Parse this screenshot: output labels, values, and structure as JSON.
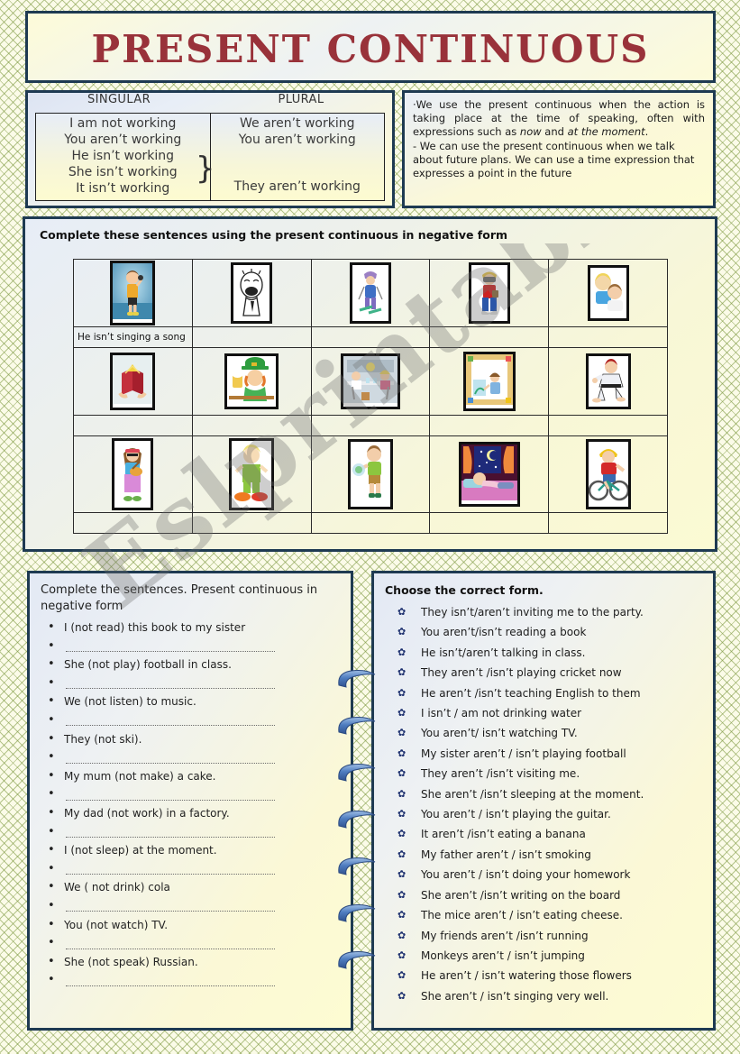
{
  "title": {
    "text": "PRESENT CONTINUOUS",
    "color": "#99323a"
  },
  "watermark": {
    "text": "Eslprintables.com"
  },
  "forms": {
    "singular_header": "SINGULAR",
    "plural_header": "PLURAL",
    "singular": [
      "I am not working",
      "You aren’t working",
      "He isn’t working",
      "She  isn’t working",
      "It isn’t working"
    ],
    "plural": [
      "We aren’t working",
      "You aren’t working",
      "They  aren’t working"
    ]
  },
  "usage": {
    "line1": "·We use  the present continuous when the action is taking place at  the  time  of  speaking,  often  with expressions such as ",
    "line1_em1": "now",
    "line1_mid": " and ",
    "line1_em2": "at the moment",
    "line1_end": ".",
    "line2": "- We can use the present continuous when we talk about future plans. We can use a time expression that expresses a point in the future"
  },
  "grid": {
    "instruction": "Complete these sentences using the present continuous in negative form",
    "rows": [
      {
        "pictures": [
          "boy-singing-microphone",
          "man-laughing-sketch",
          "girl-skiing",
          "boy-taking-photo",
          "two-girls-talking"
        ],
        "answers": [
          "He isn’t singing a song",
          "",
          "",
          "",
          ""
        ]
      },
      {
        "pictures": [
          "open-red-book",
          "leprechaun-drinking-beer",
          "kids-in-science-lab",
          "child-painting-picture",
          "boy-doing-karate"
        ],
        "answers": [
          "",
          "",
          "",
          "",
          ""
        ]
      },
      {
        "pictures": [
          "girl-playing-guitar",
          "child-running",
          "boy-playing-ball",
          "man-sleeping-in-bed",
          "boy-riding-bicycle"
        ],
        "answers": [
          "",
          "",
          "",
          "",
          ""
        ]
      }
    ]
  },
  "left_exercise": {
    "heading": "Complete the sentences. Present  continuous  in negative form",
    "items": [
      "I (not read) this book to my sister",
      "She (not play) football in class.",
      "We (not listen) to music.",
      "They (not ski).",
      "My mum (not make) a cake.",
      "My dad (not work) in a factory.",
      "I (not sleep) at the moment.",
      "We ( not drink) cola",
      "You (not watch) TV.",
      "She (not speak) Russian."
    ]
  },
  "right_exercise": {
    "heading": "Choose the correct form.",
    "items": [
      "They isn’t/aren’t inviting me to the party.",
      "You aren’t/isn’t  reading a book",
      "He isn’t/aren’t talking in class.",
      "They aren’t /isn’t playing cricket now",
      "He aren’t /isn’t teaching English to them",
      "I isn’t / am not drinking water",
      "You aren’t/ isn’t watching TV.",
      "My sister aren’t / isn’t playing football",
      "They aren’t /isn’t  visiting me.",
      "She aren’t /isn’t sleeping at the moment.",
      "You aren’t / isn’t playing the guitar.",
      "It aren’t /isn’t eating a banana",
      "My father aren’t / isn’t  smoking",
      "You aren’t / isn’t doing your homework",
      "She aren’t /isn’t writing on the board",
      "The mice aren’t / isn’t eating cheese.",
      "My friends aren’t /isn’t running",
      "Monkeys aren’t / isn’t jumping",
      "He aren’t / isn’t watering those flowers",
      "She aren’t / isn’t singing very well."
    ]
  },
  "colors": {
    "panel_border": "#1e3a52",
    "cream": "#fdfbd6",
    "pale_blue": "#e3e9f4",
    "spiral_blue": "#5b86c4"
  }
}
